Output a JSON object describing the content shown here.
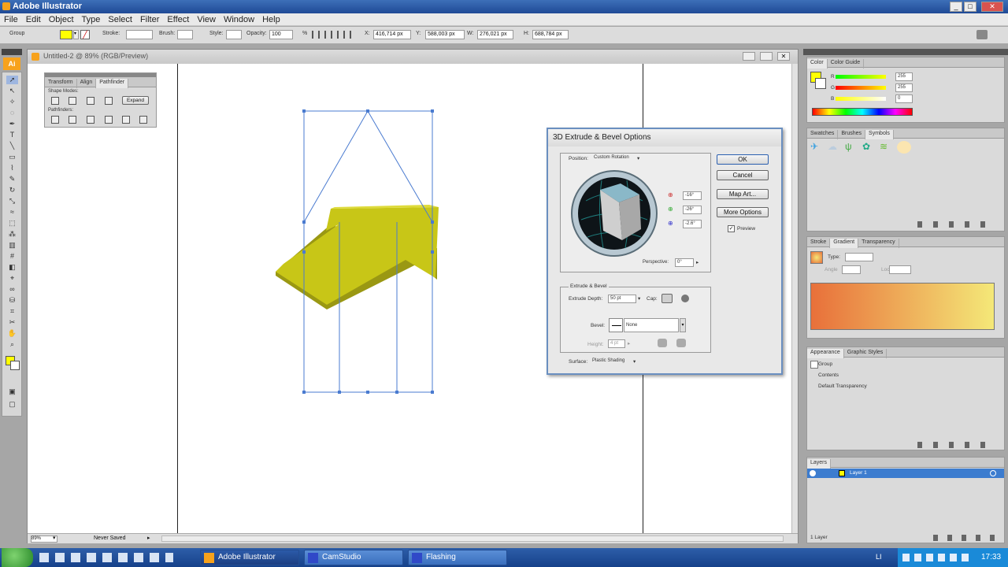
{
  "app": {
    "title": "Adobe Illustrator",
    "logo": "Ai"
  },
  "menu": [
    "File",
    "Edit",
    "Object",
    "Type",
    "Select",
    "Filter",
    "Effect",
    "View",
    "Window",
    "Help"
  ],
  "control_bar": {
    "selection_label": "Group",
    "stroke_label": "Stroke:",
    "brush_label": "Brush:",
    "style_label": "Style:",
    "opacity_label": "Opacity:",
    "opacity_value": "100",
    "opacity_unit": "%",
    "x_label": "X:",
    "x_value": "416,714 px",
    "y_label": "Y:",
    "y_value": "588,003 px",
    "w_label": "W:",
    "w_value": "276,021 px",
    "h_label": "H:",
    "h_value": "688,784 px"
  },
  "document": {
    "title": "Untitled-2 @ 89% (RGB/Preview)",
    "zoom": "89%",
    "status": "Never Saved"
  },
  "pathfinder_panel": {
    "tabs": [
      "Transform",
      "Align",
      "Pathfinder"
    ],
    "shape_modes_label": "Shape Modes:",
    "expand_label": "Expand",
    "pathfinders_label": "Pathfinders:"
  },
  "dialog": {
    "title": "3D Extrude & Bevel Options",
    "position_label": "Position:",
    "position_value": "Custom Rotation",
    "rot_x": "-16°",
    "rot_y": "-26°",
    "rot_z": "-2.6°",
    "perspective_label": "Perspective:",
    "perspective_value": "0°",
    "buttons": {
      "ok": "OK",
      "cancel": "Cancel",
      "map_art": "Map Art...",
      "more": "More Options"
    },
    "preview_label": "Preview",
    "preview_checked": true,
    "extrude_section": "Extrude & Bevel",
    "extrude_depth_label": "Extrude Depth:",
    "extrude_depth_value": "50 pt",
    "cap_label": "Cap:",
    "bevel_label": "Bevel:",
    "bevel_value": "None",
    "height_label": "Height:",
    "height_value": "4 pt",
    "surface_label": "Surface:",
    "surface_value": "Plastic Shading"
  },
  "color_panel": {
    "tabs": [
      "Color",
      "Color Guide"
    ],
    "rows": [
      {
        "label": "R",
        "value": "255"
      },
      {
        "label": "G",
        "value": "255"
      },
      {
        "label": "B",
        "value": "0"
      }
    ]
  },
  "symbols_panel": {
    "tabs": [
      "Swatches",
      "Brushes",
      "Symbols"
    ]
  },
  "gradient_panel": {
    "tabs": [
      "Stroke",
      "Gradient",
      "Transparency"
    ],
    "type_label": "Type:",
    "angle_label": "Angle",
    "location_label": "Location"
  },
  "appearance_panel": {
    "tabs": [
      "Appearance",
      "Graphic Styles"
    ],
    "items": [
      "Group",
      "Contents",
      "Default Transparency"
    ]
  },
  "layers_panel": {
    "tabs": [
      "Layers"
    ],
    "layer_name": "Layer 1",
    "footer": "1 Layer"
  },
  "taskbar": {
    "tasks": [
      "Adobe Illustrator",
      "CamStudio",
      "Flashing"
    ],
    "lang": "LI",
    "time": "17:33"
  },
  "colors": {
    "arrow_face": "#c8c617",
    "arrow_side": "#9a9813",
    "selection": "#4a7bd0",
    "gradient_start": "#e8703a",
    "gradient_end": "#f4e878"
  }
}
